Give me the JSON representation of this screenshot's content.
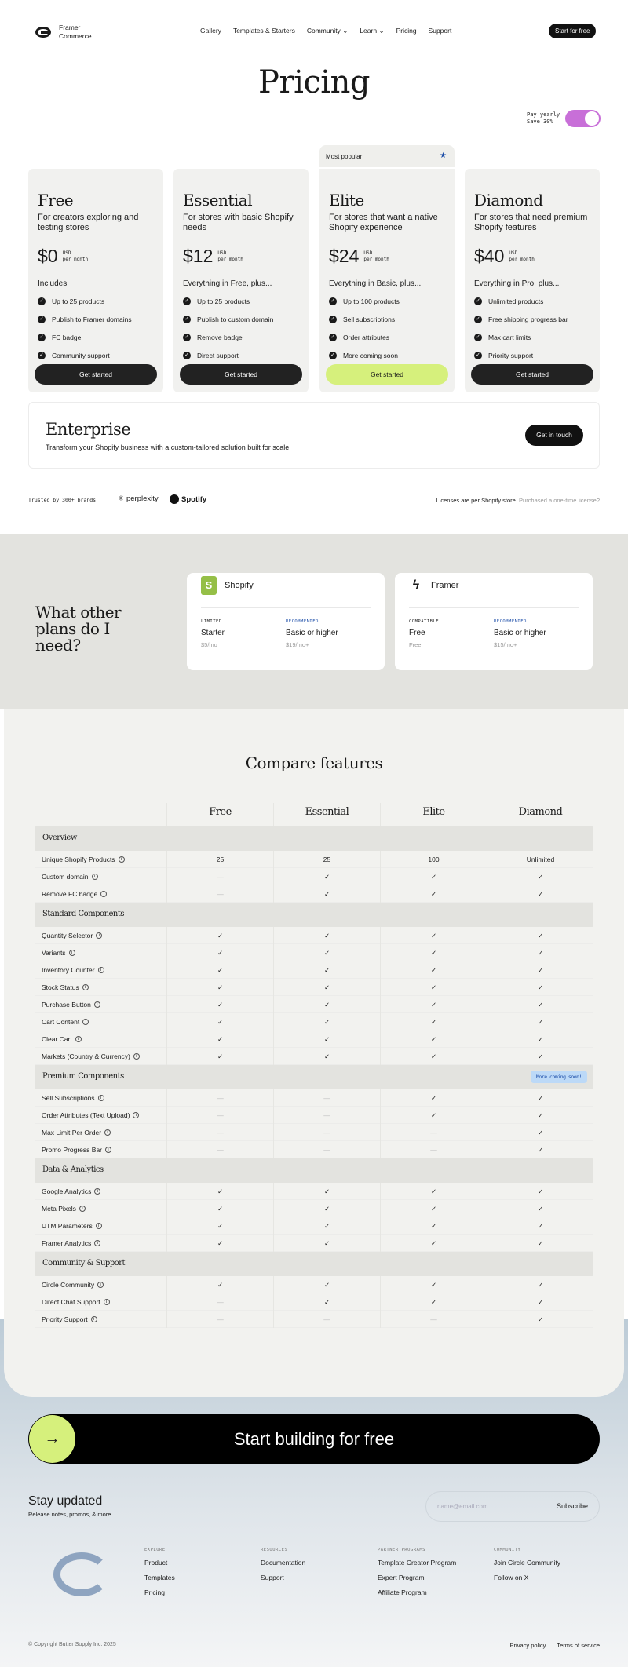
{
  "nav": {
    "brand_line1": "Framer",
    "brand_line2": "Commerce",
    "links": [
      "Gallery",
      "Templates & Starters",
      "Community",
      "Learn",
      "Pricing",
      "Support"
    ],
    "cta": "Start for free"
  },
  "pricing": {
    "title": "Pricing",
    "toggle_line1": "Pay yearly",
    "toggle_line2": "Save 30%",
    "toggle_on": true,
    "toggle_color": "#c86fd8",
    "popular_label": "Most popular",
    "plans": [
      {
        "name": "Free",
        "desc": "For creators exploring and testing stores",
        "price": "$0",
        "currency": "USD",
        "period": "per month",
        "includes": "Includes",
        "features": [
          "Up to 25 products",
          "Publish to Framer domains",
          "FC badge",
          "Community support"
        ],
        "cta": "Get started"
      },
      {
        "name": "Essential",
        "desc": "For stores with basic Shopify needs",
        "price": "$12",
        "currency": "USD",
        "period": "per month",
        "includes": "Everything in Free, plus...",
        "features": [
          "Up to 25 products",
          "Publish to custom domain",
          "Remove badge",
          "Direct support"
        ],
        "cta": "Get started"
      },
      {
        "name": "Elite",
        "desc": "For stores that want a native Shopify experience",
        "price": "$24",
        "currency": "USD",
        "period": "per month",
        "includes": "Everything in Basic, plus...",
        "features": [
          "Up to 100 products",
          "Sell subscriptions",
          "Order attributes",
          "More coming soon"
        ],
        "cta": "Get started"
      },
      {
        "name": "Diamond",
        "desc": "For stores that need premium Shopify features",
        "price": "$40",
        "currency": "USD",
        "period": "per month",
        "includes": "Everything in Pro, plus...",
        "features": [
          "Unlimited products",
          "Free shipping progress bar",
          "Max cart limits",
          "Priority support"
        ],
        "cta": "Get started"
      }
    ],
    "accent_color": "#d6f07c"
  },
  "enterprise": {
    "title": "Enterprise",
    "subtitle": "Transform your Shopify business with a custom-tailored solution built for scale",
    "cta": "Get in touch"
  },
  "trust": {
    "label": "Trusted by 300+ brands",
    "brands": [
      "perplexity",
      "Spotify"
    ],
    "license_text": "Licenses are per Shopify store.",
    "license_link": "Purchased a one-time license?"
  },
  "other_plans": {
    "title": "What other plans do I need?",
    "cards": [
      {
        "name": "Shopify",
        "cols": [
          {
            "label": "LIMITED",
            "plan": "Starter",
            "price": "$5/mo"
          },
          {
            "label": "RECOMMENDED",
            "plan": "Basic or higher",
            "price": "$19/mo+"
          }
        ]
      },
      {
        "name": "Framer",
        "cols": [
          {
            "label": "COMPATIBLE",
            "plan": "Free",
            "price": "Free"
          },
          {
            "label": "RECOMMENDED",
            "plan": "Basic or higher",
            "price": "$15/mo+"
          }
        ]
      }
    ]
  },
  "compare": {
    "title": "Compare features",
    "columns": [
      "Free",
      "Essential",
      "Elite",
      "Diamond"
    ],
    "sections": [
      {
        "name": "Overview",
        "badge": "",
        "rows": [
          {
            "name": "Unique Shopify Products",
            "values": [
              "25",
              "25",
              "100",
              "Unlimited"
            ]
          },
          {
            "name": "Custom domain",
            "values": [
              "—",
              "✓",
              "✓",
              "✓"
            ]
          },
          {
            "name": "Remove FC badge",
            "values": [
              "—",
              "✓",
              "✓",
              "✓"
            ]
          }
        ]
      },
      {
        "name": "Standard Components",
        "badge": "",
        "rows": [
          {
            "name": "Quantity Selector",
            "values": [
              "✓",
              "✓",
              "✓",
              "✓"
            ]
          },
          {
            "name": "Variants",
            "values": [
              "✓",
              "✓",
              "✓",
              "✓"
            ]
          },
          {
            "name": "Inventory Counter",
            "values": [
              "✓",
              "✓",
              "✓",
              "✓"
            ]
          },
          {
            "name": "Stock Status",
            "values": [
              "✓",
              "✓",
              "✓",
              "✓"
            ]
          },
          {
            "name": "Purchase Button",
            "values": [
              "✓",
              "✓",
              "✓",
              "✓"
            ]
          },
          {
            "name": "Cart Content",
            "values": [
              "✓",
              "✓",
              "✓",
              "✓"
            ]
          },
          {
            "name": "Clear Cart",
            "values": [
              "✓",
              "✓",
              "✓",
              "✓"
            ]
          },
          {
            "name": "Markets (Country & Currency)",
            "values": [
              "✓",
              "✓",
              "✓",
              "✓"
            ]
          }
        ]
      },
      {
        "name": "Premium Components",
        "badge": "More coming soon!",
        "rows": [
          {
            "name": "Sell Subscriptions",
            "values": [
              "—",
              "—",
              "✓",
              "✓"
            ]
          },
          {
            "name": "Order Attributes (Text Upload)",
            "values": [
              "—",
              "—",
              "✓",
              "✓"
            ]
          },
          {
            "name": "Max Limit Per Order",
            "values": [
              "—",
              "—",
              "—",
              "✓"
            ]
          },
          {
            "name": "Promo Progress Bar",
            "values": [
              "—",
              "—",
              "—",
              "✓"
            ]
          }
        ]
      },
      {
        "name": "Data & Analytics",
        "badge": "",
        "rows": [
          {
            "name": "Google Analytics",
            "values": [
              "✓",
              "✓",
              "✓",
              "✓"
            ]
          },
          {
            "name": "Meta Pixels",
            "values": [
              "✓",
              "✓",
              "✓",
              "✓"
            ]
          },
          {
            "name": "UTM Parameters",
            "values": [
              "✓",
              "✓",
              "✓",
              "✓"
            ]
          },
          {
            "name": "Framer Analytics",
            "values": [
              "✓",
              "✓",
              "✓",
              "✓"
            ]
          }
        ]
      },
      {
        "name": "Community & Support",
        "badge": "",
        "rows": [
          {
            "name": "Circle Community",
            "values": [
              "✓",
              "✓",
              "✓",
              "✓"
            ]
          },
          {
            "name": "Direct Chat Support",
            "values": [
              "—",
              "✓",
              "✓",
              "✓"
            ]
          },
          {
            "name": "Priority Support",
            "values": [
              "—",
              "—",
              "—",
              "✓"
            ]
          }
        ]
      }
    ]
  },
  "cta": {
    "label": "Start building for free"
  },
  "newsletter": {
    "title": "Stay updated",
    "subtitle": "Release notes, promos, & more",
    "placeholder": "name@email.com",
    "button": "Subscribe"
  },
  "footer": {
    "columns": [
      {
        "heading": "EXPLORE",
        "links": [
          "Product",
          "Templates",
          "Pricing"
        ]
      },
      {
        "heading": "RESOURCES",
        "links": [
          "Documentation",
          "Support"
        ]
      },
      {
        "heading": "PARTNER PROGRAMS",
        "links": [
          "Template Creator Program",
          "Expert Program",
          "Affiliate Program"
        ]
      },
      {
        "heading": "COMMUNITY",
        "links": [
          "Join Circle Community",
          "Follow on X"
        ]
      }
    ],
    "copyright": "© Copyright Butter Supply Inc. 2025",
    "legal": [
      "Privacy policy",
      "Terms of service"
    ]
  }
}
